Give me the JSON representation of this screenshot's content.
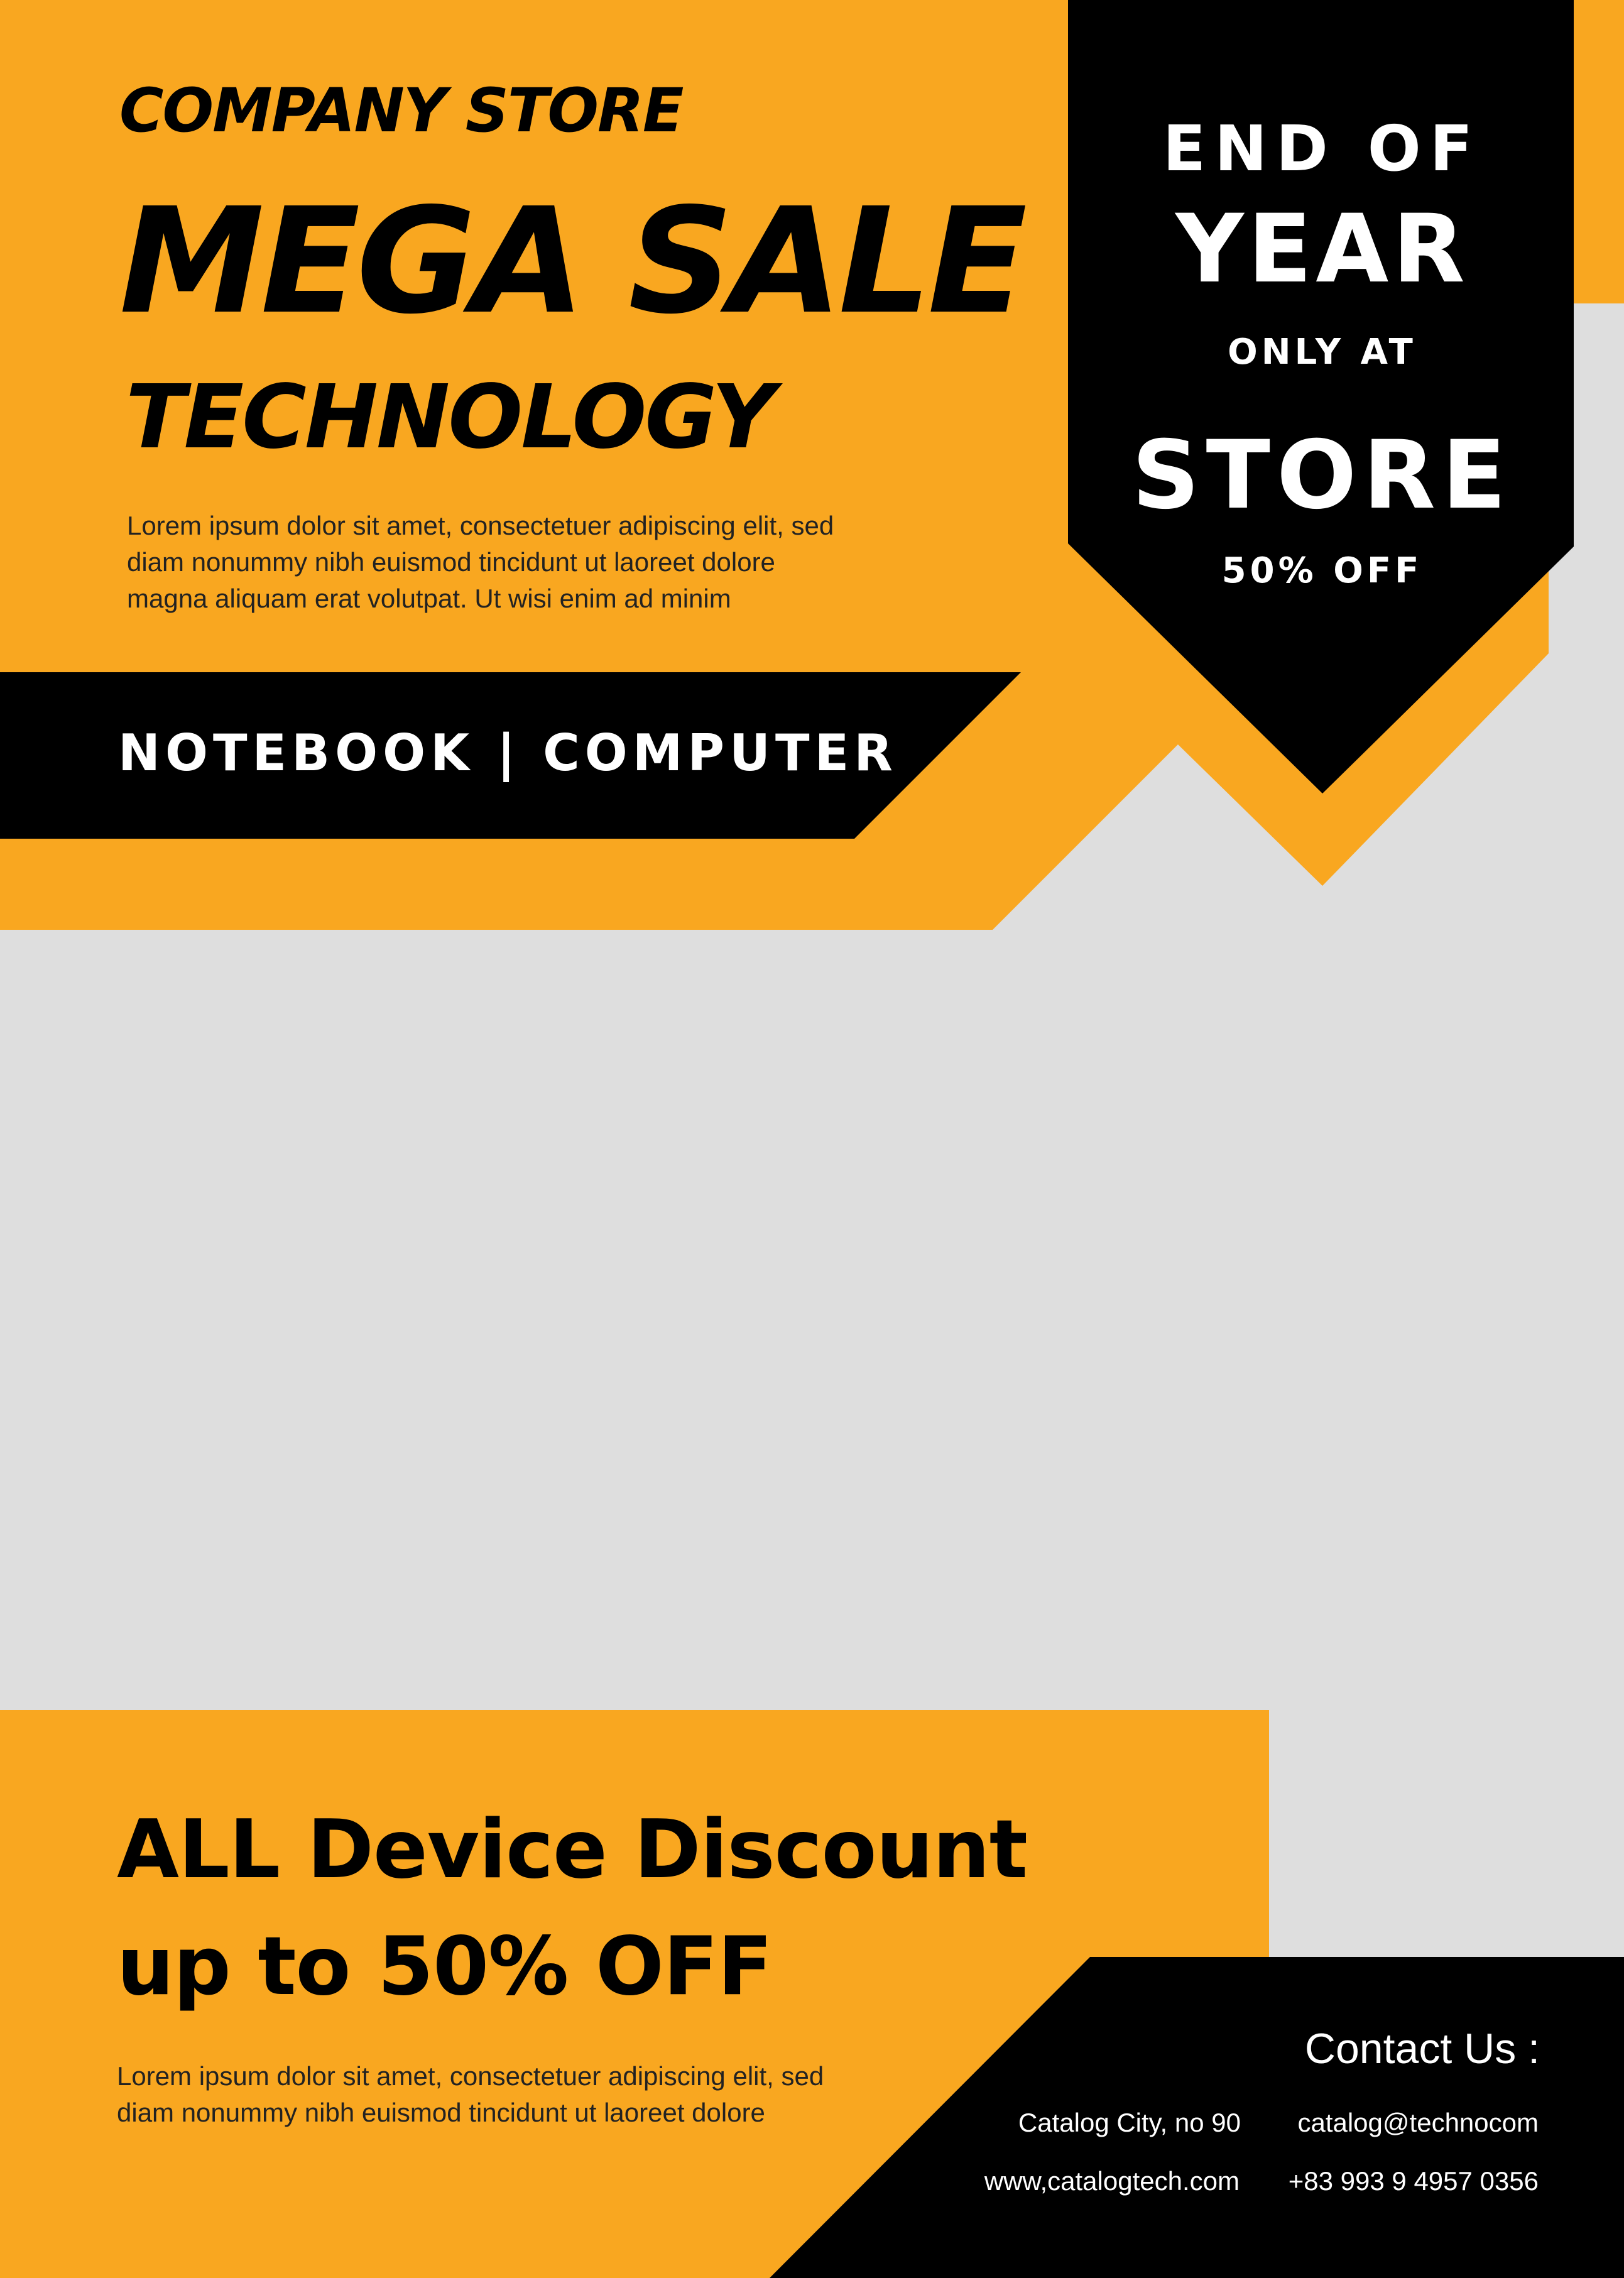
{
  "header": {
    "store_label": "COMPANY STORE",
    "headline": "MEGA SALE",
    "subhead": "TECHNOLOGY",
    "body_lines": [
      "Lorem ipsum dolor sit amet, consectetuer adipiscing elit, sed",
      "diam nonummy nibh euismod tincidunt ut laoreet dolore",
      "magna aliquam erat volutpat. Ut wisi enim ad minim"
    ],
    "category_band": "NOTEBOOK | COMPUTER"
  },
  "badge": {
    "line1": "END OF",
    "line2": "YEAR",
    "line3": "ONLY AT",
    "line4": "STORE",
    "line5": "50% OFF"
  },
  "discount": {
    "line1": "ALL Device Discount",
    "line2": "up to 50% OFF",
    "body_lines": [
      "Lorem ipsum dolor sit amet, consectetuer adipiscing elit, sed",
      "diam nonummy nibh euismod tincidunt ut laoreet dolore"
    ]
  },
  "contact": {
    "title": "Contact Us :",
    "address": "Catalog City, no 90",
    "email": "catalog@technocom",
    "website": "www,catalogtech.com",
    "phone": "+83 993 9 4957 0356"
  },
  "colors": {
    "accent": "#F9A720",
    "dark": "#000000",
    "background": "#DEDEDE",
    "text_light": "#FFFFFF"
  }
}
